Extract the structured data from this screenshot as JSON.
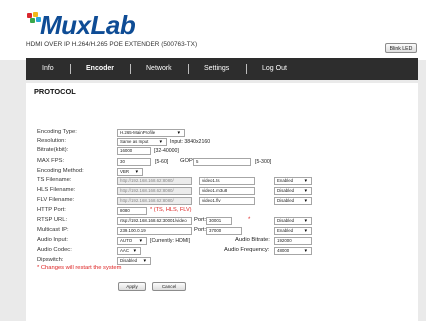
{
  "header": {
    "brand": "MuxLab",
    "subtitle": "HDMI OVER IP H.264/H.265 POE EXTENDER (500763-TX)",
    "blink_led_label": "Blink LED",
    "colors": {
      "brand_blue": "#0e4c95",
      "brand_red": "#d9272e",
      "brand_yellow": "#f2b81a",
      "brand_green": "#3aa74a",
      "brand_cyan": "#2aa6d9"
    }
  },
  "nav": {
    "items": [
      {
        "label": "Info"
      },
      {
        "label": "Encoder",
        "active": true
      },
      {
        "label": "Network"
      },
      {
        "label": "Settings"
      },
      {
        "label": "Log Out"
      }
    ]
  },
  "protocol": {
    "title": "PROTOCOL",
    "encoding_type": {
      "label": "Encoding Type:",
      "value": "H.265-MainProfile"
    },
    "resolution": {
      "label": "Resolution:",
      "value": "Same as Input",
      "input_note": "Input: 3840x2160"
    },
    "bitrate": {
      "label": "Bitrate(kbit):",
      "value": "16000",
      "range": "[32-40000]"
    },
    "max_fps": {
      "label": "MAX FPS:",
      "value": "30",
      "range": "[5-60]",
      "gop_label": "GOP:",
      "gop_value": "5",
      "gop_range": "[5-300]"
    },
    "encoding_method": {
      "label": "Encoding Method:",
      "value": "VBR"
    },
    "ts": {
      "label": "TS Filename:",
      "url": "http://192.168.168.62:8080/",
      "file": "video1.ts",
      "state": "Enabled"
    },
    "hls": {
      "label": "HLS Filename:",
      "url": "http://192.168.168.62:8080/",
      "file": "video1.m3u8",
      "state": "Disabled"
    },
    "flv": {
      "label": "FLV Filename:",
      "url": "http://192.168.168.62:8080/",
      "file": "video1.flv",
      "state": "Disabled"
    },
    "http_port": {
      "label": "HTTP Port:",
      "value": "8080",
      "note": "* (TS, HLS, FLV)"
    },
    "rtsp": {
      "label": "RTSP URL:",
      "value": "rtsp://192.168.168.62:30001/video",
      "port_label": "Port:",
      "port_value": "30001",
      "asterisk": "*",
      "state": "Disabled"
    },
    "multicast": {
      "label": "Multicast IP:",
      "value": "239.100.0.19",
      "port_label": "Port:",
      "port_value": "37000",
      "state": "Enabled"
    },
    "audio_input": {
      "label": "Audio Input:",
      "value": "AUTO",
      "current": "[Currently: HDMI]",
      "bitrate_label": "Audio Bitrate:",
      "bitrate_value": "192000"
    },
    "audio_codec": {
      "label": "Audio Codec:",
      "value": "AAC",
      "freq_label": "Audio Frequency:",
      "freq_value": "48000"
    },
    "dipswitch": {
      "label": "Dipswitch:",
      "value": "Disabled"
    },
    "warning": "* Changes will restart the system",
    "apply_label": "Apply",
    "cancel_label": "Cancel"
  }
}
